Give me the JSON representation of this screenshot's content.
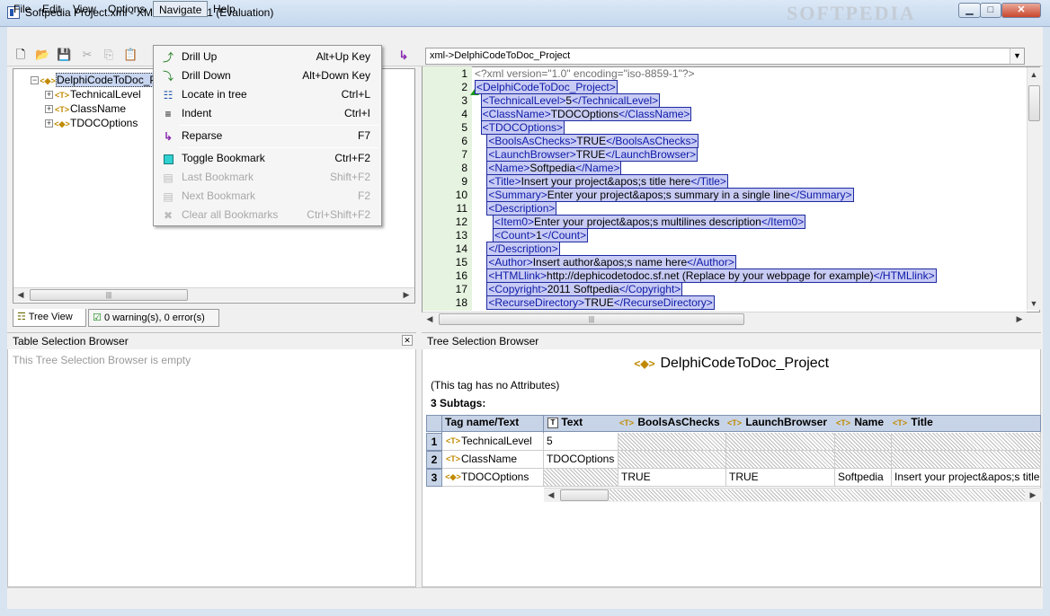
{
  "window": {
    "title": "Softpedia Project.xml - XML Marker 2.1 (Evaluation)",
    "watermark": "SOFTPEDIA",
    "controls": [
      "minimize",
      "maximize",
      "close"
    ]
  },
  "menubar": [
    "File",
    "Edit",
    "View",
    "Options",
    "Navigate",
    "Help"
  ],
  "navigate_menu": [
    {
      "icon": "drill-up-icon",
      "label": "Drill Up",
      "shortcut": "Alt+Up Key",
      "enabled": true
    },
    {
      "icon": "drill-down-icon",
      "label": "Drill Down",
      "shortcut": "Alt+Down Key",
      "enabled": true
    },
    {
      "icon": "locate-icon",
      "label": "Locate in tree",
      "shortcut": "Ctrl+L",
      "enabled": true
    },
    {
      "icon": "indent-icon",
      "label": "Indent",
      "shortcut": "Ctrl+I",
      "enabled": true
    },
    {
      "icon": "reparse-icon",
      "label": "Reparse",
      "shortcut": "F7",
      "enabled": true
    },
    {
      "icon": "bookmark-icon",
      "label": "Toggle Bookmark",
      "shortcut": "Ctrl+F2",
      "enabled": true
    },
    {
      "icon": "last-bookmark-icon",
      "label": "Last Bookmark",
      "shortcut": "Shift+F2",
      "enabled": false
    },
    {
      "icon": "next-bookmark-icon",
      "label": "Next Bookmark",
      "shortcut": "F2",
      "enabled": false
    },
    {
      "icon": "clear-bookmarks-icon",
      "label": "Clear all Bookmarks",
      "shortcut": "Ctrl+Shift+F2",
      "enabled": false
    }
  ],
  "path_combo": "xml->DelphiCodeToDoc_Project",
  "tree": {
    "root": "DelphiCodeToDoc_Project",
    "children": [
      "TechnicalLevel",
      "ClassName",
      "TDOCOptions"
    ]
  },
  "tabs": {
    "tree_view": "Tree View",
    "warnings": "0 warning(s), 0 error(s)"
  },
  "editor_lines": [
    {
      "n": "1",
      "text": "<?xml version=\"1.0\" encoding=\"iso-8859-1\"?>"
    },
    {
      "n": "2",
      "text": "<DelphiCodeToDoc_Project>"
    },
    {
      "n": "3",
      "text": "  <TechnicalLevel>5</TechnicalLevel>"
    },
    {
      "n": "4",
      "text": "  <ClassName>TDOCOptions</ClassName>"
    },
    {
      "n": "5",
      "text": "  <TDOCOptions>"
    },
    {
      "n": "6",
      "text": "    <BoolsAsChecks>TRUE</BoolsAsChecks>"
    },
    {
      "n": "7",
      "text": "    <LaunchBrowser>TRUE</LaunchBrowser>"
    },
    {
      "n": "8",
      "text": "    <Name>Softpedia</Name>"
    },
    {
      "n": "9",
      "text": "    <Title>Insert your project&apos;s title here</Title>"
    },
    {
      "n": "10",
      "text": "    <Summary>Enter your project&apos;s summary in a single line</Summary>"
    },
    {
      "n": "11",
      "text": "    <Description>"
    },
    {
      "n": "12",
      "text": "      <Item0>Enter your project&apos;s multilines description</Item0>"
    },
    {
      "n": "13",
      "text": "      <Count>1</Count>"
    },
    {
      "n": "14",
      "text": "    </Description>"
    },
    {
      "n": "15",
      "text": "    <Author>Insert author&apos;s name here</Author>"
    },
    {
      "n": "16",
      "text": "    <HTMLlink>http://dephicodetodoc.sf.net (Replace by your webpage for example)</HTMLlink>"
    },
    {
      "n": "17",
      "text": "    <Copyright>2011 Softpedia</Copyright>"
    },
    {
      "n": "18",
      "text": "    <RecurseDirectory>TRUE</RecurseDirectory>"
    }
  ],
  "table_browser": {
    "title": "Table Selection Browser",
    "empty_text": "This Tree Selection Browser is empty"
  },
  "tree_browser": {
    "title": "Tree Selection Browser",
    "node_name": "DelphiCodeToDoc_Project",
    "attributes_note": "(This tag has no Attributes)",
    "subtags_label": "3 Subtags:",
    "columns": [
      "Tag name/Text",
      "Text",
      "BoolsAsChecks",
      "LaunchBrowser",
      "Name",
      "Title"
    ],
    "rows": [
      {
        "num": "1",
        "tag": "TechnicalLevel",
        "text": "5",
        "bools": "",
        "launch": "",
        "name": "",
        "title": ""
      },
      {
        "num": "2",
        "tag": "ClassName",
        "text": "TDOCOptions",
        "bools": "",
        "launch": "",
        "name": "",
        "title": ""
      },
      {
        "num": "3",
        "tag": "TDOCOptions",
        "text": "",
        "bools": "TRUE",
        "launch": "TRUE",
        "name": "Softpedia",
        "title": "Insert your project&apos;s title"
      }
    ]
  },
  "colors": {
    "tag_highlight": "#c8cbf4",
    "tag_text": "#0d1aa8",
    "gutter": "#e6f3e0",
    "menu_bg": "#f5f5f5"
  }
}
